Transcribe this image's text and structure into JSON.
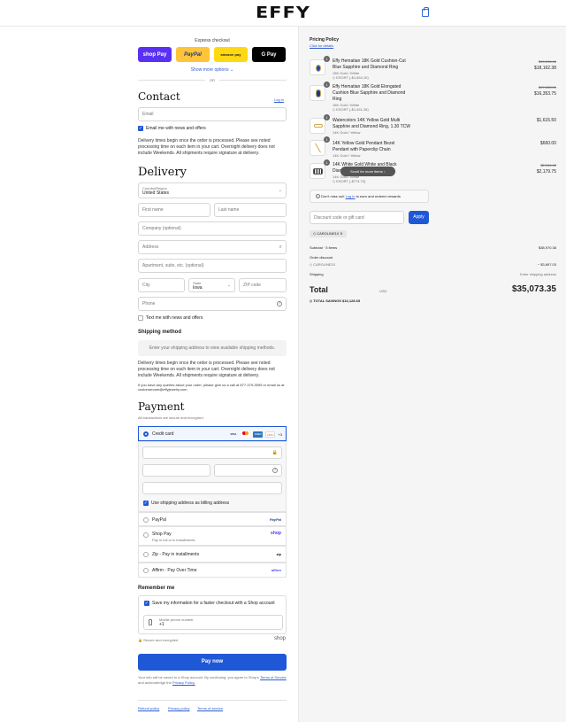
{
  "header": {
    "logo": "EFFY"
  },
  "express": {
    "title": "Express checkout",
    "buttons": [
      {
        "label": "shop Pay",
        "color": "#5a31f4"
      },
      {
        "label": "PayPal",
        "color": "#ffc439"
      },
      {
        "label": "amazon pay",
        "color": "#ffd814"
      },
      {
        "label": "G Pay",
        "color": "#000000"
      }
    ],
    "more": "Show more options",
    "or": "OR"
  },
  "contact": {
    "heading": "Contact",
    "login": "Log in",
    "email_placeholder": "Email",
    "news": "Email me with news and offers",
    "notice": "Delivery times begin once the order is processed. Please see noted processing time on each item in your cart. Overnight delivery does not include Weekends. All shipments require signature at delivery."
  },
  "delivery": {
    "heading": "Delivery",
    "country_label": "Country/Region",
    "country": "United States",
    "first": "First name",
    "last": "Last name",
    "company": "Company (optional)",
    "address": "Address",
    "apt": "Apartment, suite, etc. (optional)",
    "city": "City",
    "state_label": "State",
    "state": "Iowa",
    "zip": "ZIP code",
    "phone": "Phone",
    "text_me": "Text me with news and offers"
  },
  "shipping": {
    "heading": "Shipping method",
    "placeholder": "Enter your shipping address to view available shipping methods.",
    "notice": "Delivery times begin once the order is processed. Please see noted processing time on each item in your cart. Overnight delivery does not include Weekends. All shipments require signature at delivery.",
    "small": "If you have any queries about your order, please give us a call at 877-379-3599 or email us at customercare@effyjewelry.com"
  },
  "payment": {
    "heading": "Payment",
    "sub": "All transactions are secure and encrypted.",
    "credit": "Credit card",
    "cards": [
      "VISA",
      "MC",
      "AMEX",
      "DISC"
    ],
    "more_cards": "+3",
    "billing": "Use shipping address as billing address",
    "options": [
      {
        "label": "PayPal",
        "brand": "PayPal"
      },
      {
        "label": "Shop Pay",
        "sub": "Pay in full or in installments",
        "brand": "shop"
      },
      {
        "label": "Zip - Pay in installments",
        "brand": "zip"
      },
      {
        "label": "Affirm - Pay Over Time",
        "brand": "affirm"
      }
    ]
  },
  "remember": {
    "heading": "Remember me",
    "save": "Save my information for a faster checkout with a Shop account",
    "mobile_label": "Mobile phone number",
    "mobile": "+1",
    "secure": "Secure and encrypted",
    "shop": "shop"
  },
  "pay_button": "Pay now",
  "legal": {
    "text": "Your info will be saved to a Shop account. By continuing, you agree to Shop's",
    "terms": "Terms of Service",
    "and": "and acknowledge the",
    "privacy": "Privacy Policy."
  },
  "footer": [
    "Refund policy",
    "Privacy policy",
    "Terms of service"
  ],
  "summary": {
    "pricing": "Pricing Policy",
    "click": "Click for details",
    "items": [
      {
        "qty": "1",
        "name": "Effy Hematian 18K Gold Cushion-Cut Blue Sapphire and Diamond Ring",
        "variant": "18K Gold / White",
        "tag": "ESORT (-$1,654.10)",
        "old": "$19,816.48",
        "price": "$18,162.38"
      },
      {
        "qty": "1",
        "name": "Effy Hematian 18K Gold Elongated Cushion Blue Sapphire and Diamond Ring",
        "variant": "18K Gold / White",
        "tag": "ESORT (-$1,451.26)",
        "old": "$17,805.01",
        "price": "$16,353.75"
      },
      {
        "qty": "1",
        "name": "Watercolors 14K Yellow Gold Multi Sapphire and Diamond Ring, 1.30 TCW",
        "variant": "14K Gold / Yellow",
        "old": "",
        "price": "$1,615.50"
      },
      {
        "qty": "1",
        "name": "14K Yellow Gold Pendant Bezel Pendant with Paperclip Chain",
        "variant": "14K Gold / Yellow",
        "old": "",
        "price": "$660.00"
      },
      {
        "qty": "1",
        "name": "14K White Gold White and Black Diamond Ring",
        "variant": "14K Gold / White",
        "tag": "ESORT (-$774.70)",
        "old": "$2,954.45",
        "price": "$2,179.75"
      }
    ],
    "scroll": "Scroll for more items",
    "rewards_pre": "Don't miss out!",
    "rewards_link": "Log in",
    "rewards_post": "to earn and redeem rewards",
    "discount_placeholder": "Discount code or gift card",
    "apply": "Apply",
    "code": "CAROLINE10",
    "subtotal_label": "Subtotal · 5 items",
    "subtotal": "$38,970.38",
    "order_discount": "Order discount",
    "discount_code": "CAROLINE10",
    "discount": "− $3,897.03",
    "shipping_label": "Shipping",
    "shipping": "Enter shipping address",
    "total_label": "Total",
    "currency": "USD",
    "total": "$35,073.35",
    "savings_label": "TOTAL SAVINGS",
    "savings": "$16,128.65"
  }
}
